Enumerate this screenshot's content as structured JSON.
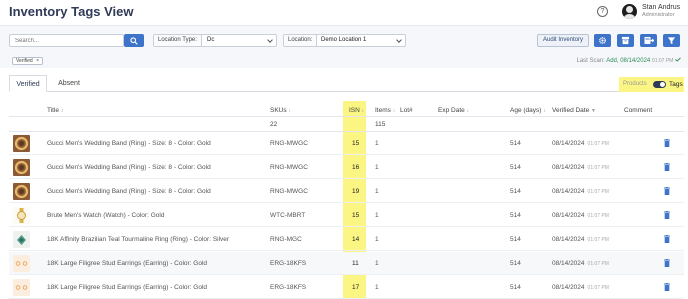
{
  "header": {
    "title": "Inventory Tags View",
    "help_icon_glyph": "?",
    "user_name": "Stan Andrus",
    "user_role": "Administrator"
  },
  "filters": {
    "search_placeholder": "Search...",
    "location_type_label": "Location Type:",
    "location_type_value": "Dc",
    "location_label": "Location:",
    "location_value": "Demo Location 1",
    "audit_button": "Audit Inventory",
    "active_chip": "Verified",
    "chip_close": "×",
    "last_scan_label": "Last Scan:",
    "last_scan_value": "Add, 08/14/2024",
    "last_scan_time": "01:07 PM"
  },
  "tabs": [
    {
      "label": "Verified",
      "active": true
    },
    {
      "label": "Absent",
      "active": false
    }
  ],
  "toggle": {
    "left_label": "Products",
    "right_label": "Tags",
    "on": true
  },
  "sort_glyph": "↕",
  "sort_desc_glyph": "▼",
  "columns": {
    "title": "Title",
    "skus": "SKUs",
    "isn": "ISN",
    "items": "Items",
    "lot": "Lot#",
    "exp_date": "Exp Date",
    "age": "Age (days)",
    "verified_date": "Verified Date",
    "comment": "Comment"
  },
  "summary": {
    "skus": "22",
    "items": "115"
  },
  "rows": [
    {
      "thumb": "ring",
      "title": "Gucci Men's Wedding Band (Ring) - Size: 8 - Color: Gold",
      "sku": "RNG-MWGC",
      "isn": "15",
      "items": "1",
      "age": "514",
      "date": "08/14/2024",
      "time": "01:07 PM"
    },
    {
      "thumb": "ring",
      "title": "Gucci Men's Wedding Band (Ring) - Size: 8 - Color: Gold",
      "sku": "RNG-MWGC",
      "isn": "16",
      "items": "1",
      "age": "514",
      "date": "08/14/2024",
      "time": "01:07 PM"
    },
    {
      "thumb": "ring",
      "title": "Gucci Men's Wedding Band (Ring) - Size: 8 - Color: Gold",
      "sku": "RNG-MWGC",
      "isn": "19",
      "items": "1",
      "age": "514",
      "date": "08/14/2024",
      "time": "01:07 PM"
    },
    {
      "thumb": "watch",
      "title": "Brute Men's Watch (Watch) - Color: Gold",
      "sku": "WTC-MBRT",
      "isn": "15",
      "items": "1",
      "age": "514",
      "date": "08/14/2024",
      "time": "01:07 PM"
    },
    {
      "thumb": "gem",
      "title": "18K Affinity Brazilian Teal Tourmaline Ring (Ring) - Color: Silver",
      "sku": "RNG-MGC",
      "isn": "14",
      "items": "1",
      "age": "514",
      "date": "08/14/2024",
      "time": "01:07 PM"
    },
    {
      "thumb": "earring",
      "title": "18K Large Filigree Stud Earrings (Earring) - Color: Gold",
      "sku": "ERG-18KFS",
      "isn": "11",
      "items": "1",
      "age": "514",
      "date": "08/14/2024",
      "time": "01:07 PM"
    },
    {
      "thumb": "earring",
      "title": "18K Large Filigree Stud Earrings (Earring) - Color: Gold",
      "sku": "ERG-18KFS",
      "isn": "17",
      "items": "1",
      "age": "514",
      "date": "08/14/2024",
      "time": "01:07 PM"
    }
  ],
  "colors": {
    "accent": "#3d73c8",
    "highlight": "#fbf584",
    "title": "#2f3a56",
    "trash": "#3d73c8"
  }
}
